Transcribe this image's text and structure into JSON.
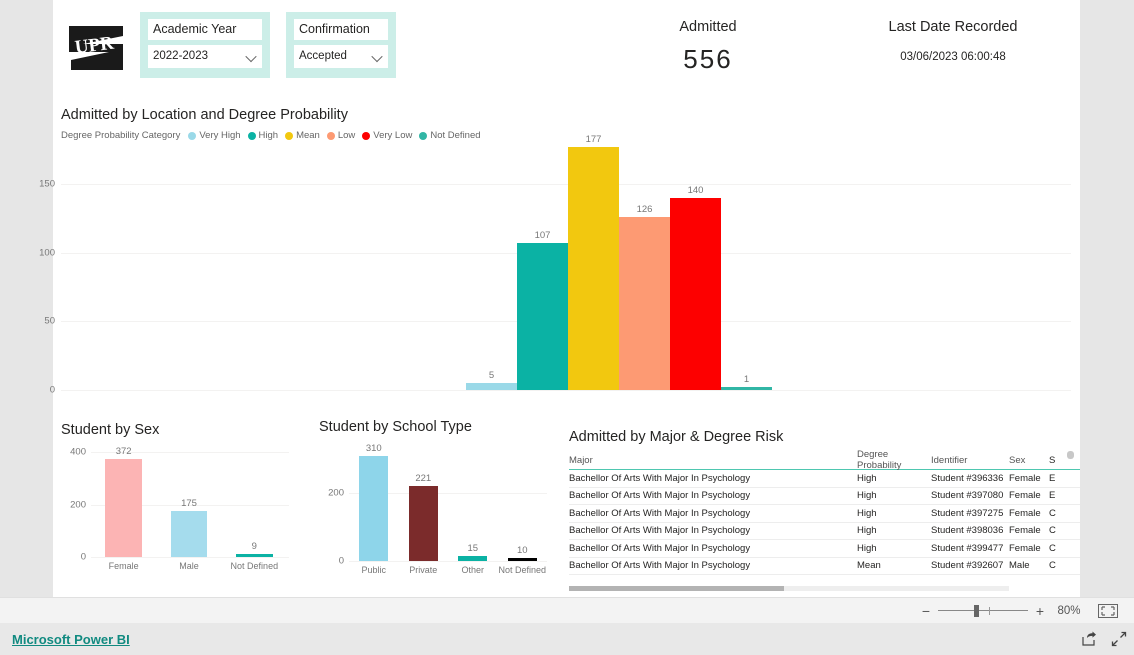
{
  "header": {
    "logo_text": "UPR",
    "slicers": [
      {
        "name": "academic-year",
        "title": "Academic Year",
        "value": "2022-2023"
      },
      {
        "name": "confirmation",
        "title": "Confirmation",
        "value": "Accepted"
      }
    ],
    "kpis": [
      {
        "label": "Admitted",
        "value": "556"
      },
      {
        "label": "Last Date Recorded",
        "value": "03/06/2023 06:00:48"
      }
    ]
  },
  "main_chart": {
    "title": "Admitted by Location and Degree Probability",
    "legend_title": "Degree Probability Category"
  },
  "sex_chart": {
    "title": "Student by Sex"
  },
  "school_chart": {
    "title": "Student by School Type"
  },
  "table_visual": {
    "title": "Admitted by Major & Degree Risk",
    "columns": [
      "Major",
      "Degree Probability",
      "Identifier",
      "Sex",
      "S"
    ],
    "rows": [
      [
        "Bachellor Of Arts With Major In Psychology",
        "High",
        "Student #396336",
        "Female",
        "E"
      ],
      [
        "Bachellor Of Arts With Major In Psychology",
        "High",
        "Student #397080",
        "Female",
        "E"
      ],
      [
        "Bachellor Of Arts With Major In Psychology",
        "High",
        "Student #397275",
        "Female",
        "C"
      ],
      [
        "Bachellor Of Arts With Major In Psychology",
        "High",
        "Student #398036",
        "Female",
        "C"
      ],
      [
        "Bachellor Of Arts With Major In Psychology",
        "High",
        "Student #399477",
        "Female",
        "C"
      ],
      [
        "Bachellor Of Arts With Major In Psychology",
        "Mean",
        "Student #392607",
        "Male",
        "C"
      ]
    ]
  },
  "zoom_bar": {
    "minus": "−",
    "plus": "+",
    "percent": "80%",
    "fit_icon": "fit-to-page-icon"
  },
  "footer": {
    "brand": "Microsoft Power BI",
    "share_icon": "share-icon",
    "fullscreen_icon": "fullscreen-icon"
  },
  "chart_data": [
    {
      "id": "main",
      "type": "bar",
      "title": "Admitted by Location and Degree Probability",
      "legend_title": "Degree Probability Category",
      "legend_position": "top",
      "categories": [
        "Very High",
        "High",
        "Mean",
        "Low",
        "Very Low",
        "Not Defined"
      ],
      "values": [
        5,
        107,
        177,
        126,
        140,
        1
      ],
      "colors": [
        "#9ad9e8",
        "#0bb2a4",
        "#f2c80f",
        "#fd9a73",
        "#fd0000",
        "#31b6a5"
      ],
      "xlabel": "",
      "ylabel": "",
      "ylim": [
        0,
        175
      ],
      "yticks": [
        0,
        50,
        100,
        150
      ],
      "grid": true,
      "xtick_labels_visible": false
    },
    {
      "id": "sex",
      "type": "bar",
      "title": "Student by Sex",
      "categories": [
        "Female",
        "Male",
        "Not Defined"
      ],
      "values": [
        372,
        175,
        9
      ],
      "colors": [
        "#fcb4b4",
        "#a5dced",
        "#0bb2a4"
      ],
      "xlabel": "",
      "ylabel": "",
      "ylim": [
        0,
        400
      ],
      "yticks": [
        0,
        200,
        400
      ],
      "grid": true
    },
    {
      "id": "school",
      "type": "bar",
      "title": "Student by School Type",
      "categories": [
        "Public",
        "Private",
        "Other",
        "Not Defined"
      ],
      "values": [
        310,
        221,
        15,
        10
      ],
      "colors": [
        "#8ed5ea",
        "#7b2b2b",
        "#0bb2a4",
        "#000000"
      ],
      "xlabel": "",
      "ylabel": "",
      "ylim": [
        0,
        330
      ],
      "yticks": [
        0,
        200
      ],
      "grid": true
    }
  ]
}
